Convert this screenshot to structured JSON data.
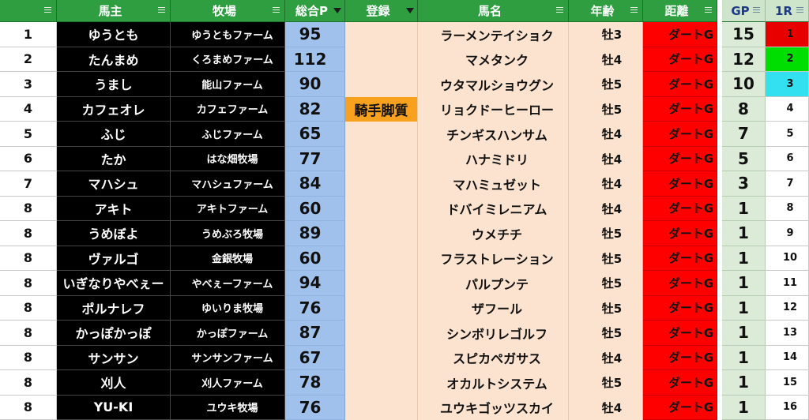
{
  "colors": {
    "header_green": "#2e9e41",
    "owner_black": "#000000",
    "points_blue": "#9fc1ec",
    "peach": "#fbe3cf",
    "flag_orange": "#f7a11f",
    "distance_red": "#ff0000",
    "gp_green": "#dcebd8",
    "r1_first": "#e60000",
    "r1_second": "#00dd00",
    "r1_third": "#33e0f0"
  },
  "headers": {
    "rank": "",
    "owner": "馬主",
    "farm": "牧場",
    "points": "総合P",
    "registration": "登録",
    "horse": "馬名",
    "age": "年齢",
    "distance": "距離",
    "gp": "GP",
    "r1": "1R"
  },
  "rows": [
    {
      "rank": "1",
      "owner": "ゆうとも",
      "farm": "ゆうともファーム",
      "points": "95",
      "registration": "",
      "horse": "ラーメンテイショク",
      "age": "牡3",
      "distance": "ダートG",
      "gp": "15",
      "r1": "1",
      "r1_color": "#e60000"
    },
    {
      "rank": "2",
      "owner": "たんまめ",
      "farm": "くろまめファーム",
      "points": "112",
      "registration": "",
      "horse": "マメタンク",
      "age": "牡4",
      "distance": "ダートG",
      "gp": "12",
      "r1": "2",
      "r1_color": "#00dd00"
    },
    {
      "rank": "3",
      "owner": "うまし",
      "farm": "能山ファーム",
      "points": "90",
      "registration": "",
      "horse": "ウタマルショウグン",
      "age": "牡5",
      "distance": "ダートG",
      "gp": "10",
      "r1": "3",
      "r1_color": "#33e0f0"
    },
    {
      "rank": "4",
      "owner": "カフェオレ",
      "farm": "カフェファーム",
      "points": "82",
      "registration": "騎手脚質",
      "horse": "リョクドーヒーロー",
      "age": "牡5",
      "distance": "ダートG",
      "gp": "8",
      "r1": "4",
      "r1_color": ""
    },
    {
      "rank": "5",
      "owner": "ふじ",
      "farm": "ふじファーム",
      "points": "65",
      "registration": "",
      "horse": "チンギスハンサム",
      "age": "牡4",
      "distance": "ダートG",
      "gp": "7",
      "r1": "5",
      "r1_color": ""
    },
    {
      "rank": "6",
      "owner": "たか",
      "farm": "はな畑牧場",
      "points": "77",
      "registration": "",
      "horse": "ハナミドリ",
      "age": "牡4",
      "distance": "ダートG",
      "gp": "5",
      "r1": "6",
      "r1_color": ""
    },
    {
      "rank": "7",
      "owner": "マハシュ",
      "farm": "マハシュファーム",
      "points": "84",
      "registration": "",
      "horse": "マハミュゼット",
      "age": "牡4",
      "distance": "ダートG",
      "gp": "3",
      "r1": "7",
      "r1_color": ""
    },
    {
      "rank": "8",
      "owner": "アキト",
      "farm": "アキトファーム",
      "points": "60",
      "registration": "",
      "horse": "ドバイミレニアム",
      "age": "牡4",
      "distance": "ダートG",
      "gp": "1",
      "r1": "8",
      "r1_color": ""
    },
    {
      "rank": "8",
      "owner": "うめぼよ",
      "farm": "うめぶろ牧場",
      "points": "89",
      "registration": "",
      "horse": "ウメチチ",
      "age": "牡5",
      "distance": "ダートG",
      "gp": "1",
      "r1": "9",
      "r1_color": ""
    },
    {
      "rank": "8",
      "owner": "ヴァルゴ",
      "farm": "金銀牧場",
      "points": "60",
      "registration": "",
      "horse": "フラストレーション",
      "age": "牡5",
      "distance": "ダートG",
      "gp": "1",
      "r1": "10",
      "r1_color": ""
    },
    {
      "rank": "8",
      "owner": "いぎなりやべぇー",
      "farm": "やべぇーファーム",
      "points": "94",
      "registration": "",
      "horse": "パルプンテ",
      "age": "牡5",
      "distance": "ダートG",
      "gp": "1",
      "r1": "11",
      "r1_color": ""
    },
    {
      "rank": "8",
      "owner": "ポルナレフ",
      "farm": "ゆいりま牧場",
      "points": "76",
      "registration": "",
      "horse": "ザフール",
      "age": "牡5",
      "distance": "ダートG",
      "gp": "1",
      "r1": "12",
      "r1_color": ""
    },
    {
      "rank": "8",
      "owner": "かっぽかっぽ",
      "farm": "かっぽファーム",
      "points": "87",
      "registration": "",
      "horse": "シンボリレゴルフ",
      "age": "牡5",
      "distance": "ダートG",
      "gp": "1",
      "r1": "13",
      "r1_color": ""
    },
    {
      "rank": "8",
      "owner": "サンサン",
      "farm": "サンサンファーム",
      "points": "67",
      "registration": "",
      "horse": "スピカペガサス",
      "age": "牡4",
      "distance": "ダートG",
      "gp": "1",
      "r1": "14",
      "r1_color": ""
    },
    {
      "rank": "8",
      "owner": "刈人",
      "farm": "刈人ファーム",
      "points": "78",
      "registration": "",
      "horse": "オカルトシステム",
      "age": "牡5",
      "distance": "ダートG",
      "gp": "1",
      "r1": "15",
      "r1_color": ""
    },
    {
      "rank": "8",
      "owner": "YU-KI",
      "farm": "ユウキ牧場",
      "points": "76",
      "registration": "",
      "horse": "ユウキゴッツスカイ",
      "age": "牡4",
      "distance": "ダートG",
      "gp": "1",
      "r1": "16",
      "r1_color": ""
    }
  ]
}
